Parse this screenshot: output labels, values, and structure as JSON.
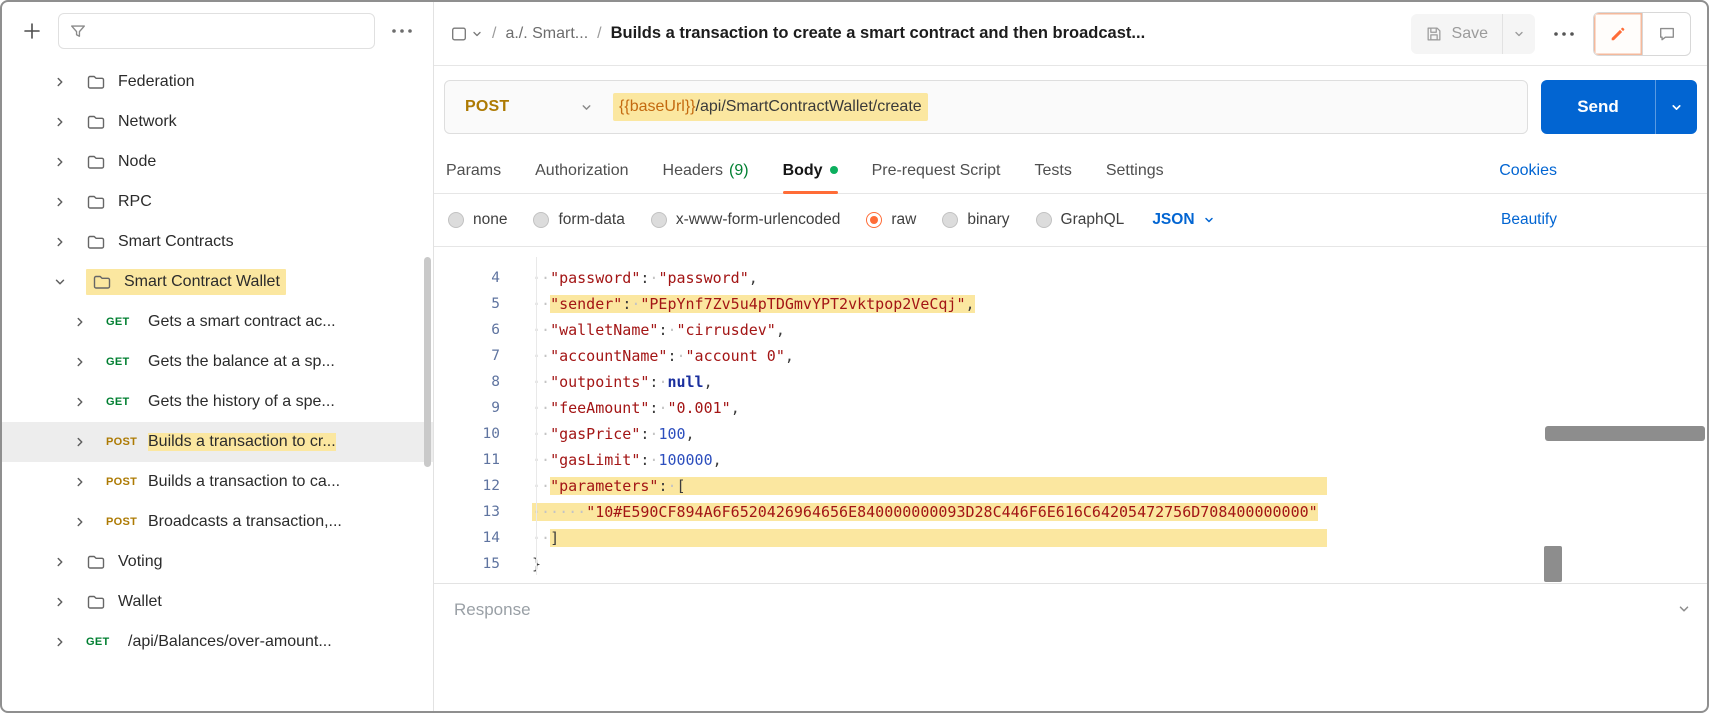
{
  "sidebar": {
    "items": [
      {
        "kind": "folder",
        "label": "Federation",
        "depth": 0
      },
      {
        "kind": "folder",
        "label": "Network",
        "depth": 0
      },
      {
        "kind": "folder",
        "label": "Node",
        "depth": 0
      },
      {
        "kind": "folder",
        "label": "RPC",
        "depth": 0
      },
      {
        "kind": "folder",
        "label": "Smart Contracts",
        "depth": 0
      },
      {
        "kind": "folder",
        "label": "Smart Contract Wallet",
        "depth": 0,
        "expanded": true,
        "highlight": true
      },
      {
        "kind": "request",
        "method": "GET",
        "label": "Gets a smart contract ac...",
        "depth": 1
      },
      {
        "kind": "request",
        "method": "GET",
        "label": "Gets the balance at a sp...",
        "depth": 1
      },
      {
        "kind": "request",
        "method": "GET",
        "label": "Gets the history of a spe...",
        "depth": 1
      },
      {
        "kind": "request",
        "method": "POST",
        "label": "Builds a transaction to cr...",
        "depth": 1,
        "selected": true,
        "highlight": true
      },
      {
        "kind": "request",
        "method": "POST",
        "label": "Builds a transaction to ca...",
        "depth": 1
      },
      {
        "kind": "request",
        "method": "POST",
        "label": "Broadcasts a transaction,...",
        "depth": 1
      },
      {
        "kind": "folder",
        "label": "Voting",
        "depth": 0
      },
      {
        "kind": "folder",
        "label": "Wallet",
        "depth": 0
      },
      {
        "kind": "request",
        "method": "GET",
        "label": "/api/Balances/over-amount...",
        "depth": 0
      }
    ]
  },
  "header": {
    "path": "a./. Smart...",
    "title": "Builds a transaction to create a smart contract and then broadcast...",
    "save_label": "Save"
  },
  "request": {
    "method": "POST",
    "url_variable": "{{baseUrl}}",
    "url_path": "/api/SmartContractWallet/create",
    "send_label": "Send"
  },
  "tabs": [
    {
      "label": "Params"
    },
    {
      "label": "Authorization"
    },
    {
      "label": "Headers",
      "count": "(9)"
    },
    {
      "label": "Body",
      "active": true,
      "dot": true
    },
    {
      "label": "Pre-request Script"
    },
    {
      "label": "Tests"
    },
    {
      "label": "Settings"
    }
  ],
  "links": {
    "cookies": "Cookies",
    "beautify": "Beautify"
  },
  "body": {
    "options": [
      {
        "label": "none"
      },
      {
        "label": "form-data"
      },
      {
        "label": "x-www-form-urlencoded"
      },
      {
        "label": "raw",
        "selected": true
      },
      {
        "label": "binary"
      },
      {
        "label": "GraphQL"
      }
    ],
    "language": "JSON"
  },
  "editor": {
    "lines": [
      {
        "num": 4,
        "segs": [
          {
            "c": "w",
            "t": "··"
          },
          {
            "c": "k",
            "t": "\"password\""
          },
          {
            "c": "p",
            "t": ":"
          },
          {
            "c": "w",
            "t": "·"
          },
          {
            "c": "s",
            "t": "\"password\""
          },
          {
            "c": "p",
            "t": ","
          }
        ]
      },
      {
        "num": 5,
        "segs": [
          {
            "c": "w",
            "t": "··"
          },
          {
            "c": "k",
            "t": "\"sender\"",
            "h": true
          },
          {
            "c": "p",
            "t": ":",
            "h": true
          },
          {
            "c": "w",
            "t": "·",
            "h": true
          },
          {
            "c": "s",
            "t": "\"PEpYnf7Zv5u4pTDGmvYPT2vktpop2VeCqj\"",
            "h": true
          },
          {
            "c": "p",
            "t": ",",
            "h": true
          }
        ]
      },
      {
        "num": 6,
        "segs": [
          {
            "c": "w",
            "t": "··"
          },
          {
            "c": "k",
            "t": "\"walletName\""
          },
          {
            "c": "p",
            "t": ":"
          },
          {
            "c": "w",
            "t": "·"
          },
          {
            "c": "s",
            "t": "\"cirrusdev\""
          },
          {
            "c": "p",
            "t": ","
          }
        ]
      },
      {
        "num": 7,
        "segs": [
          {
            "c": "w",
            "t": "··"
          },
          {
            "c": "k",
            "t": "\"accountName\""
          },
          {
            "c": "p",
            "t": ":"
          },
          {
            "c": "w",
            "t": "·"
          },
          {
            "c": "s",
            "t": "\"account 0\""
          },
          {
            "c": "p",
            "t": ","
          }
        ]
      },
      {
        "num": 8,
        "segs": [
          {
            "c": "w",
            "t": "··"
          },
          {
            "c": "k",
            "t": "\"outpoints\""
          },
          {
            "c": "p",
            "t": ":"
          },
          {
            "c": "w",
            "t": "·"
          },
          {
            "c": "kw",
            "t": "null"
          },
          {
            "c": "p",
            "t": ","
          }
        ]
      },
      {
        "num": 9,
        "segs": [
          {
            "c": "w",
            "t": "··"
          },
          {
            "c": "k",
            "t": "\"feeAmount\""
          },
          {
            "c": "p",
            "t": ":"
          },
          {
            "c": "w",
            "t": "·"
          },
          {
            "c": "s",
            "t": "\"0.001\""
          },
          {
            "c": "p",
            "t": ","
          }
        ]
      },
      {
        "num": 10,
        "segs": [
          {
            "c": "w",
            "t": "··"
          },
          {
            "c": "k",
            "t": "\"gasPrice\""
          },
          {
            "c": "p",
            "t": ":"
          },
          {
            "c": "w",
            "t": "·"
          },
          {
            "c": "n",
            "t": "100"
          },
          {
            "c": "p",
            "t": ","
          }
        ]
      },
      {
        "num": 11,
        "segs": [
          {
            "c": "w",
            "t": "··"
          },
          {
            "c": "k",
            "t": "\"gasLimit\""
          },
          {
            "c": "p",
            "t": ":"
          },
          {
            "c": "w",
            "t": "·"
          },
          {
            "c": "n",
            "t": "100000"
          },
          {
            "c": "p",
            "t": ","
          }
        ]
      },
      {
        "num": 12,
        "segs": [
          {
            "c": "w",
            "t": "··"
          },
          {
            "c": "k",
            "t": "\"parameters\"",
            "h": true
          },
          {
            "c": "p",
            "t": ":",
            "h": true
          },
          {
            "c": "w",
            "t": "·",
            "h": true
          },
          {
            "c": "p",
            "t": "[",
            "h": true
          },
          {
            "c": "f",
            "n": 71,
            "h": true
          }
        ]
      },
      {
        "num": 13,
        "segs": [
          {
            "c": "w",
            "t": "······",
            "h": true
          },
          {
            "c": "s",
            "t": "\"10#E590CF894A6F6520426964656E840000000093D28C446F6E616C64205472756D708400000000\"",
            "h": true
          }
        ]
      },
      {
        "num": 14,
        "segs": [
          {
            "c": "w",
            "t": "··"
          },
          {
            "c": "p",
            "t": "]",
            "h": true
          },
          {
            "c": "f",
            "n": 85,
            "h": true
          }
        ]
      },
      {
        "num": 15,
        "segs": [
          {
            "c": "p",
            "t": "}"
          }
        ]
      }
    ]
  },
  "response": {
    "label": "Response"
  },
  "colors": {
    "highlight": "#fbe7a0",
    "accent_orange": "#ff6c37",
    "link_blue": "#0265d2",
    "get_green": "#007f31",
    "post_yellow": "#ad7a03"
  }
}
